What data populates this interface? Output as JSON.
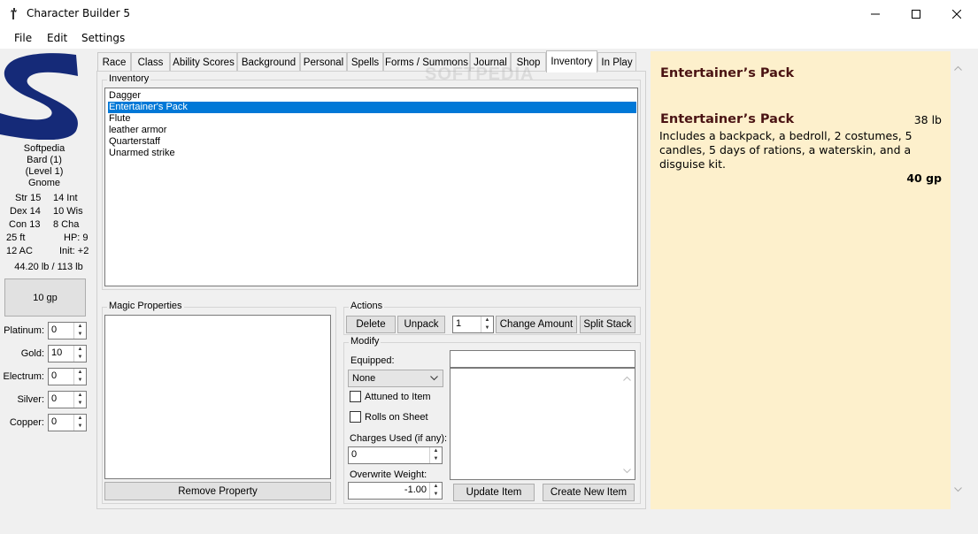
{
  "window": {
    "title": "Character Builder 5"
  },
  "menu": [
    "File",
    "Edit",
    "Settings"
  ],
  "character": {
    "name": "Softpedia",
    "class_level": "Bard (1)",
    "level": "(Level 1)",
    "race": "Gnome",
    "stats": {
      "str": "Str 15",
      "int": "14 Int",
      "dex": "Dex 14",
      "wis": "10 Wis",
      "con": "Con 13",
      "cha": "8 Cha",
      "speed": "25 ft",
      "hp": "HP: 9",
      "ac": "12 AC",
      "init": "Init: +2",
      "weight": "44.20 lb / 113 lb"
    },
    "gp_display": "10 gp",
    "coins": [
      {
        "label": "Platinum:",
        "value": "0"
      },
      {
        "label": "Gold:",
        "value": "10"
      },
      {
        "label": "Electrum:",
        "value": "0"
      },
      {
        "label": "Silver:",
        "value": "0"
      },
      {
        "label": "Copper:",
        "value": "0"
      }
    ]
  },
  "tabs": [
    "Race",
    "Class",
    "Ability Scores",
    "Background",
    "Personal",
    "Spells",
    "Forms / Summons",
    "Journal",
    "Shop",
    "Inventory",
    "In Play"
  ],
  "active_tab": "Inventory",
  "inventory": {
    "label": "Inventory",
    "items": [
      "Dagger",
      "Entertainer's Pack",
      "Flute",
      "leather armor",
      "Quarterstaff",
      "Unarmed strike"
    ],
    "selected_item": "Entertainer's Pack"
  },
  "magic_properties": {
    "label": "Magic Properties",
    "remove_button": "Remove Property"
  },
  "actions": {
    "label": "Actions",
    "delete": "Delete",
    "unpack": "Unpack",
    "amount": "1",
    "change_amount": "Change Amount",
    "split_stack": "Split Stack"
  },
  "modify": {
    "label": "Modify",
    "equipped_label": "Equipped:",
    "equipped_value": "None",
    "attuned": "Attuned to Item",
    "rolls_on_sheet": "Rolls on Sheet",
    "charges_label": "Charges Used (if any):",
    "charges_value": "0",
    "weight_label": "Overwrite Weight:",
    "weight_value": "-1.00",
    "update_item": "Update Item",
    "create_new_item": "Create New Item"
  },
  "detail": {
    "heading": "Entertainer’s Pack",
    "item_name": "Entertainer’s Pack",
    "weight": "38 lb",
    "description": "Includes a backpack, a bedroll, 2 costumes, 5 candles, 5 days of rations, a waterskin, and a disguise kit.",
    "price": "40 gp"
  },
  "watermark": "SOFTPEDIA",
  "colors": {
    "selection": "#0078d7",
    "detail_bg": "#fdf0cc",
    "detail_title": "#4a1313",
    "logo_blue": "#152a78"
  }
}
